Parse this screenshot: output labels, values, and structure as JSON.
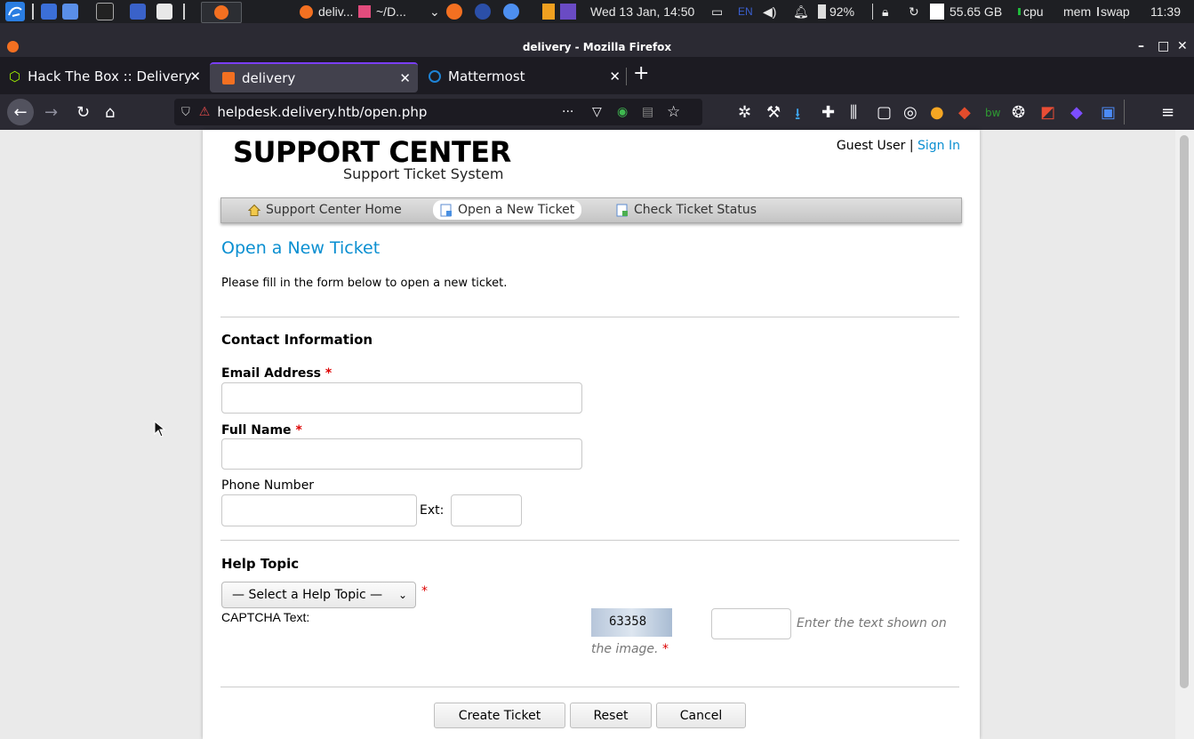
{
  "panel": {
    "task1": "deliv...",
    "task2": "~/D...",
    "datetime": "Wed 13 Jan, 14:50",
    "lang": "EN",
    "battery": "92%",
    "disk": "55.65 GB",
    "cpu": "cpu",
    "mem": "mem",
    "swap": "swap",
    "clock": "11:39"
  },
  "window": {
    "title": "delivery - Mozilla Firefox"
  },
  "tabs": [
    {
      "label": "Hack The Box :: Delivery"
    },
    {
      "label": "delivery"
    },
    {
      "label": "Mattermost"
    }
  ],
  "urlbar": {
    "url": "helpdesk.delivery.htb/open.php",
    "more": "···"
  },
  "page": {
    "logo_title": "SUPPORT CENTER",
    "logo_sub": "Support Ticket System",
    "guest": "Guest User",
    "sep": "|",
    "signin": "Sign In",
    "nav": {
      "home": "Support Center Home",
      "open": "Open a New Ticket",
      "status": "Check Ticket Status"
    },
    "heading": "Open a New Ticket",
    "intro": "Please fill in the form below to open a new ticket.",
    "contact_title": "Contact Information",
    "email_label": "Email Address",
    "name_label": "Full Name",
    "phone_label": "Phone Number",
    "ext_label": "Ext:",
    "required_mark": "*",
    "help_title": "Help Topic",
    "help_select": "— Select a Help Topic —",
    "captcha_label": "CAPTCHA Text:",
    "captcha_code": "63358",
    "captcha_hint1": "Enter the text shown on",
    "captcha_hint2": "the image.",
    "buttons": {
      "create": "Create Ticket",
      "reset": "Reset",
      "cancel": "Cancel"
    }
  }
}
